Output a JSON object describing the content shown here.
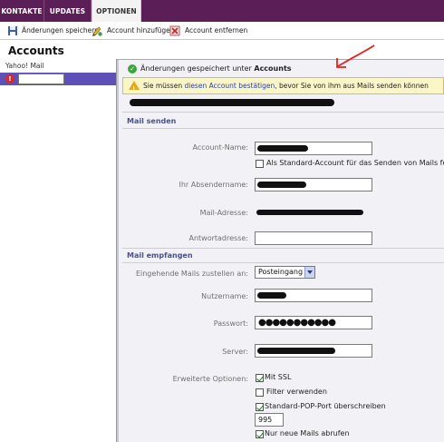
{
  "tabs": [
    {
      "label": "KONTAKTE"
    },
    {
      "label": "UPDATES"
    },
    {
      "label": "OPTIONEN"
    }
  ],
  "toolbar": {
    "save_label": "Änderungen speichern",
    "add_label": "Account hinzufügen",
    "remove_label": "Account entfernen"
  },
  "page_title": "Accounts",
  "sidebar": {
    "group_label": "Yahoo! Mail"
  },
  "messages": {
    "ok_prefix": "Änderungen gespeichert unter ",
    "ok_bold": "Accounts",
    "warn_prefix": "Sie müssen ",
    "warn_link": "diesen Account bestätigen",
    "warn_suffix": ", bevor Sie von ihm aus Mails senden können"
  },
  "send": {
    "section_title": "Mail senden",
    "account_name_label": "Account-Name:",
    "default_label": "Als Standard-Account für das Senden von Mails festl",
    "sender_name_label": "Ihr Absendername:",
    "mail_address_label": "Mail-Adresse:",
    "reply_address_label": "Antwortadresse:"
  },
  "receive": {
    "section_title": "Mail empfangen",
    "deliver_label": "Eingehende Mails zustellen an:",
    "deliver_value": "Posteingang",
    "username_label": "Nutzername:",
    "password_label": "Passwort:",
    "password_mask": "●●●●●●●●●●●",
    "server_label": "Server:",
    "advanced_label": "Erweiterte Optionen:",
    "ssl_label": "Mit SSL",
    "filter_label": "Filter verwenden",
    "port_override_label": "Standard-POP-Port überschreiben",
    "port_value": "995",
    "new_only_label": "Nur neue Mails abrufen"
  },
  "colors": {
    "topbar": "#5c1e57",
    "selected_account": "#5d50b8",
    "section_title": "#4a4f8a",
    "warn_bg": "#fbf6c8",
    "annotation": "#e0231f"
  }
}
